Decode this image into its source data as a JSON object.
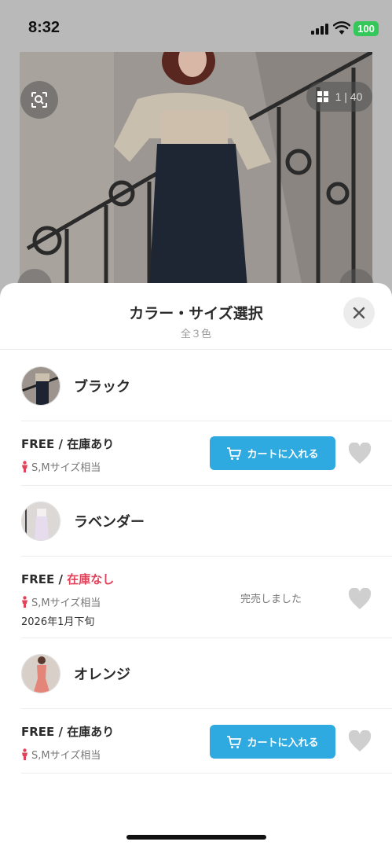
{
  "status_bar": {
    "time": "8:32",
    "battery": "100"
  },
  "gallery": {
    "counter": "1 | 40"
  },
  "sheet": {
    "title": "カラー・サイズ選択",
    "subtitle": "全３色"
  },
  "variants": [
    {
      "color_name": "ブラック",
      "size_label": "FREE / ",
      "stock_label": "在庫あり",
      "fit": "S,Mサイズ相当",
      "cart_label": "カートに入れる"
    },
    {
      "color_name": "ラベンダー",
      "size_label": "FREE / ",
      "stock_label": "在庫なし",
      "fit": "S,Mサイズ相当",
      "restock_date": "2026年1月下旬",
      "soldout_label": "完売しました"
    },
    {
      "color_name": "オレンジ",
      "size_label": "FREE / ",
      "stock_label": "在庫あり",
      "fit": "S,Mサイズ相当",
      "cart_label": "カートに入れる"
    }
  ],
  "colors": {
    "accent_button": "#2eaae1",
    "out_of_stock": "#e0435a",
    "battery": "#35c759"
  }
}
